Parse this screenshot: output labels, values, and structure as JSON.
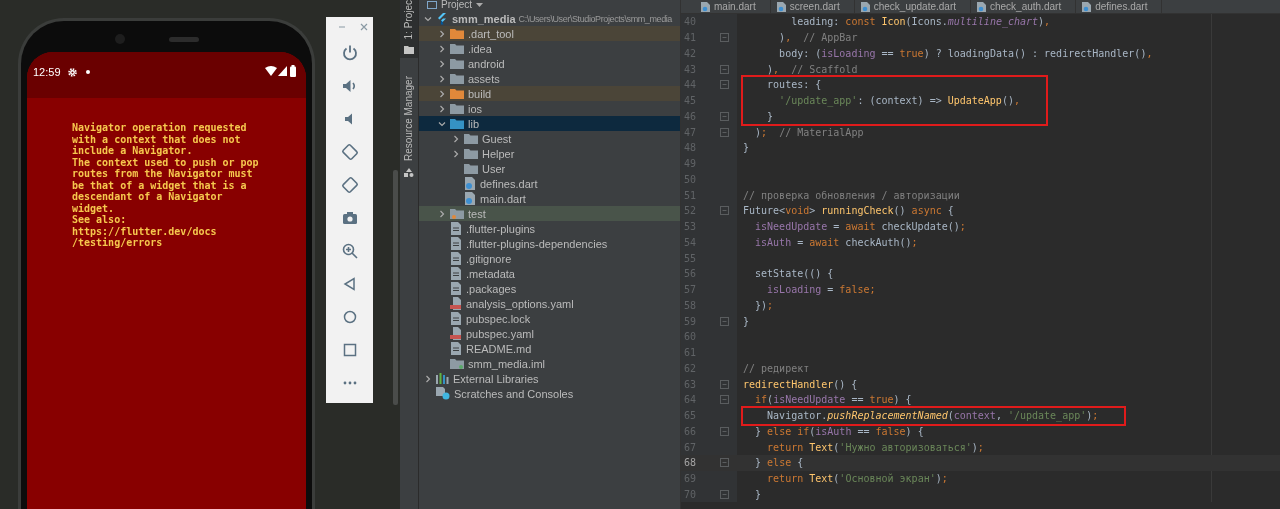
{
  "emulator": {
    "status_bar": {
      "time": "12:59"
    },
    "error_message": "Navigator operation requested\nwith a context that does not\ninclude a Navigator.\nThe context used to push or pop\nroutes from the Navigator must\nbe that of a widget that is a\ndescendant of a Navigator\nwidget.\nSee also:\nhttps://flutter.dev/docs\n/testing/errors"
  },
  "tool_strip": [
    {
      "label": "1: Projec",
      "selected": true
    },
    {
      "label": "Resource Manager",
      "selected": false
    }
  ],
  "project": {
    "title": "Project",
    "tree": [
      {
        "name": "smm_media",
        "path": "C:\\Users\\User\\StudioProjects\\smm_media",
        "kind": "flutter",
        "expanded": true,
        "selected": false,
        "children": [
          {
            "name": ".dart_tool",
            "kind": "folder-excluded",
            "expanded": false,
            "selected": false,
            "color": "#4b4538"
          },
          {
            "name": ".idea",
            "kind": "folder",
            "expanded": false,
            "selected": false
          },
          {
            "name": "android",
            "kind": "folder",
            "expanded": false,
            "selected": false
          },
          {
            "name": "assets",
            "kind": "folder",
            "expanded": false,
            "selected": false
          },
          {
            "name": "build",
            "kind": "folder-excluded",
            "expanded": false,
            "selected": false,
            "color": "#4b4538"
          },
          {
            "name": "ios",
            "kind": "folder",
            "expanded": false,
            "selected": false
          },
          {
            "name": "lib",
            "kind": "folder-source",
            "expanded": true,
            "selected": true,
            "children": [
              {
                "name": "Guest",
                "kind": "folder",
                "expanded": false,
                "selected": false
              },
              {
                "name": "Helper",
                "kind": "folder",
                "expanded": false,
                "selected": false
              },
              {
                "name": "User",
                "kind": "folder",
                "selected": false
              },
              {
                "name": "defines.dart",
                "kind": "dart",
                "selected": false
              },
              {
                "name": "main.dart",
                "kind": "dart",
                "selected": false
              }
            ]
          },
          {
            "name": "test",
            "kind": "folder-test",
            "expanded": false,
            "selected": false,
            "color": "#49544a"
          },
          {
            "name": ".flutter-plugins",
            "kind": "file",
            "selected": false
          },
          {
            "name": ".flutter-plugins-dependencies",
            "kind": "file",
            "selected": false
          },
          {
            "name": ".gitignore",
            "kind": "file",
            "selected": false
          },
          {
            "name": ".metadata",
            "kind": "file",
            "selected": false
          },
          {
            "name": ".packages",
            "kind": "file",
            "selected": false
          },
          {
            "name": "analysis_options.yaml",
            "kind": "yaml",
            "selected": false
          },
          {
            "name": "pubspec.lock",
            "kind": "file",
            "selected": false
          },
          {
            "name": "pubspec.yaml",
            "kind": "yaml",
            "selected": false
          },
          {
            "name": "README.md",
            "kind": "file",
            "selected": false
          },
          {
            "name": "smm_media.iml",
            "kind": "module",
            "selected": false
          }
        ]
      },
      {
        "name": "External Libraries",
        "kind": "libraries",
        "expanded": false,
        "selected": false
      },
      {
        "name": "Scratches and Consoles",
        "kind": "scratches",
        "selected": false
      }
    ]
  },
  "editor": {
    "tabs": [
      {
        "label": "main.dart"
      },
      {
        "label": "screen.dart"
      },
      {
        "label": "check_update.dart"
      },
      {
        "label": "check_auth.dart"
      },
      {
        "label": "defines.dart"
      }
    ],
    "blocks": [
      {
        "boxed": false,
        "lines": [
          {
            "number": "40",
            "fold": false,
            "current": false,
            "tokens": [
              {
                "text": "        leading: ",
                "kind": "plain"
              },
              {
                "text": "const ",
                "kind": "keyword"
              },
              {
                "text": "Icon",
                "kind": "func"
              },
              {
                "text": "(Icons.",
                "kind": "plain"
              },
              {
                "text": "multiline_chart",
                "kind": "constant"
              },
              {
                "text": ")",
                "kind": "plain"
              },
              {
                "text": ",",
                "kind": "keyword"
              }
            ]
          },
          {
            "number": "41",
            "fold": true,
            "current": false,
            "tokens": [
              {
                "text": "      )",
                "kind": "plain"
              },
              {
                "text": ",",
                "kind": "keyword"
              },
              {
                "text": "  // AppBar",
                "kind": "comment"
              }
            ]
          },
          {
            "number": "42",
            "fold": false,
            "current": false,
            "tokens": [
              {
                "text": "      body: (",
                "kind": "plain"
              },
              {
                "text": "isLoading",
                "kind": "field"
              },
              {
                "text": " == ",
                "kind": "plain"
              },
              {
                "text": "true",
                "kind": "keyword"
              },
              {
                "text": ") ? loadingData() : redirectHandler()",
                "kind": "plain"
              },
              {
                "text": ",",
                "kind": "keyword"
              }
            ]
          },
          {
            "number": "43",
            "fold": true,
            "current": false,
            "tokens": [
              {
                "text": "    )",
                "kind": "plain"
              },
              {
                "text": ",",
                "kind": "keyword"
              },
              {
                "text": "  // Scaffold",
                "kind": "comment"
              }
            ]
          }
        ]
      },
      {
        "boxed": true,
        "lines": [
          {
            "number": "44",
            "fold": true,
            "current": false,
            "tokens": [
              {
                "text": "    routes: {",
                "kind": "plain"
              }
            ]
          },
          {
            "number": "45",
            "fold": false,
            "current": false,
            "tokens": [
              {
                "text": "      '/update_app'",
                "kind": "string"
              },
              {
                "text": ": (context) => ",
                "kind": "plain"
              },
              {
                "text": "UpdateApp",
                "kind": "func"
              },
              {
                "text": "()",
                "kind": "plain"
              },
              {
                "text": ",",
                "kind": "keyword"
              }
            ]
          },
          {
            "number": "46",
            "fold": true,
            "current": false,
            "tokens": [
              {
                "text": "    }",
                "kind": "plain"
              }
            ]
          }
        ]
      },
      {
        "boxed": false,
        "lines": [
          {
            "number": "47",
            "fold": true,
            "current": false,
            "tokens": [
              {
                "text": "  )",
                "kind": "plain"
              },
              {
                "text": ";",
                "kind": "keyword"
              },
              {
                "text": "  // MaterialApp",
                "kind": "comment"
              }
            ]
          },
          {
            "number": "48",
            "fold": false,
            "current": false,
            "tokens": [
              {
                "text": "}",
                "kind": "plain"
              }
            ]
          },
          {
            "number": "49",
            "fold": false,
            "current": false
          },
          {
            "number": "50",
            "fold": false,
            "current": false
          },
          {
            "number": "51",
            "fold": false,
            "current": false,
            "tokens": [
              {
                "text": "// проверка обновления / авторизации",
                "kind": "comment"
              }
            ]
          },
          {
            "number": "52",
            "fold": true,
            "current": false,
            "tokens": [
              {
                "text": "Future<",
                "kind": "plain"
              },
              {
                "text": "void",
                "kind": "keyword"
              },
              {
                "text": "> ",
                "kind": "plain"
              },
              {
                "text": "runningCheck",
                "kind": "func"
              },
              {
                "text": "() ",
                "kind": "plain"
              },
              {
                "text": "async",
                "kind": "keyword"
              },
              {
                "text": " {",
                "kind": "plain"
              }
            ]
          },
          {
            "number": "53",
            "fold": false,
            "current": false,
            "tokens": [
              {
                "text": "  isNeedUpdate",
                "kind": "field"
              },
              {
                "text": " = ",
                "kind": "plain"
              },
              {
                "text": "await",
                "kind": "keyword"
              },
              {
                "text": " checkUpdate()",
                "kind": "plain"
              },
              {
                "text": ";",
                "kind": "keyword"
              }
            ]
          },
          {
            "number": "54",
            "fold": false,
            "current": false,
            "tokens": [
              {
                "text": "  isAuth",
                "kind": "field"
              },
              {
                "text": " = ",
                "kind": "plain"
              },
              {
                "text": "await",
                "kind": "keyword"
              },
              {
                "text": " checkAuth()",
                "kind": "plain"
              },
              {
                "text": ";",
                "kind": "keyword"
              }
            ]
          },
          {
            "number": "55",
            "fold": false,
            "current": false
          },
          {
            "number": "56",
            "fold": false,
            "current": false,
            "tokens": [
              {
                "text": "  setState(() {",
                "kind": "plain"
              }
            ]
          },
          {
            "number": "57",
            "fold": false,
            "current": false,
            "tokens": [
              {
                "text": "    isLoading",
                "kind": "field"
              },
              {
                "text": " = ",
                "kind": "plain"
              },
              {
                "text": "false",
                "kind": "keyword"
              },
              {
                "text": ";",
                "kind": "keyword"
              }
            ]
          },
          {
            "number": "58",
            "fold": false,
            "current": false,
            "tokens": [
              {
                "text": "  })",
                "kind": "plain"
              },
              {
                "text": ";",
                "kind": "keyword"
              }
            ]
          },
          {
            "number": "59",
            "fold": true,
            "current": false,
            "tokens": [
              {
                "text": "}",
                "kind": "plain"
              }
            ]
          },
          {
            "number": "60",
            "fold": false,
            "current": false
          },
          {
            "number": "61",
            "fold": false,
            "current": false
          },
          {
            "number": "62",
            "fold": false,
            "current": false,
            "tokens": [
              {
                "text": "// редирект",
                "kind": "comment"
              }
            ]
          },
          {
            "number": "63",
            "fold": true,
            "current": false,
            "tokens": [
              {
                "text": "redirectHandler",
                "kind": "func"
              },
              {
                "text": "() {",
                "kind": "plain"
              }
            ]
          },
          {
            "number": "64",
            "fold": true,
            "current": false,
            "tokens": [
              {
                "text": "  if",
                "kind": "keyword"
              },
              {
                "text": "(",
                "kind": "plain"
              },
              {
                "text": "isNeedUpdate",
                "kind": "field"
              },
              {
                "text": " == ",
                "kind": "plain"
              },
              {
                "text": "true",
                "kind": "keyword"
              },
              {
                "text": ") {",
                "kind": "plain"
              }
            ]
          }
        ]
      },
      {
        "boxed": true,
        "lines": [
          {
            "number": "65",
            "fold": false,
            "current": false,
            "tokens": [
              {
                "text": "    Navigator.",
                "kind": "plain"
              },
              {
                "text": "pushReplacementNamed",
                "kind": "static"
              },
              {
                "text": "(",
                "kind": "plain"
              },
              {
                "text": "context",
                "kind": "field"
              },
              {
                "text": ", ",
                "kind": "plain"
              },
              {
                "text": "'/update_app'",
                "kind": "string"
              },
              {
                "text": ")",
                "kind": "plain"
              },
              {
                "text": ";",
                "kind": "keyword"
              }
            ]
          }
        ]
      },
      {
        "boxed": false,
        "lines": [
          {
            "number": "66",
            "fold": true,
            "current": false,
            "tokens": [
              {
                "text": "  } ",
                "kind": "plain"
              },
              {
                "text": "else if",
                "kind": "keyword"
              },
              {
                "text": "(",
                "kind": "plain"
              },
              {
                "text": "isAuth",
                "kind": "field"
              },
              {
                "text": " == ",
                "kind": "plain"
              },
              {
                "text": "false",
                "kind": "keyword"
              },
              {
                "text": ") {",
                "kind": "plain"
              }
            ]
          },
          {
            "number": "67",
            "fold": false,
            "current": false,
            "tokens": [
              {
                "text": "    return ",
                "kind": "keyword"
              },
              {
                "text": "Text",
                "kind": "func"
              },
              {
                "text": "(",
                "kind": "plain"
              },
              {
                "text": "'Нужно авторизоваться'",
                "kind": "string"
              },
              {
                "text": ")",
                "kind": "plain"
              },
              {
                "text": ";",
                "kind": "keyword"
              }
            ]
          },
          {
            "number": "68",
            "fold": true,
            "current": true,
            "tokens": [
              {
                "text": "  } ",
                "kind": "plain"
              },
              {
                "text": "else",
                "kind": "keyword"
              },
              {
                "text": " {",
                "kind": "plain"
              }
            ]
          },
          {
            "number": "69",
            "fold": false,
            "current": false,
            "tokens": [
              {
                "text": "    return ",
                "kind": "keyword"
              },
              {
                "text": "Text",
                "kind": "func"
              },
              {
                "text": "(",
                "kind": "plain"
              },
              {
                "text": "'Основной экран'",
                "kind": "string"
              },
              {
                "text": ")",
                "kind": "plain"
              },
              {
                "text": ";",
                "kind": "keyword"
              }
            ]
          },
          {
            "number": "70",
            "fold": true,
            "current": false,
            "tokens": [
              {
                "text": "  }",
                "kind": "plain"
              }
            ]
          }
        ]
      }
    ]
  }
}
